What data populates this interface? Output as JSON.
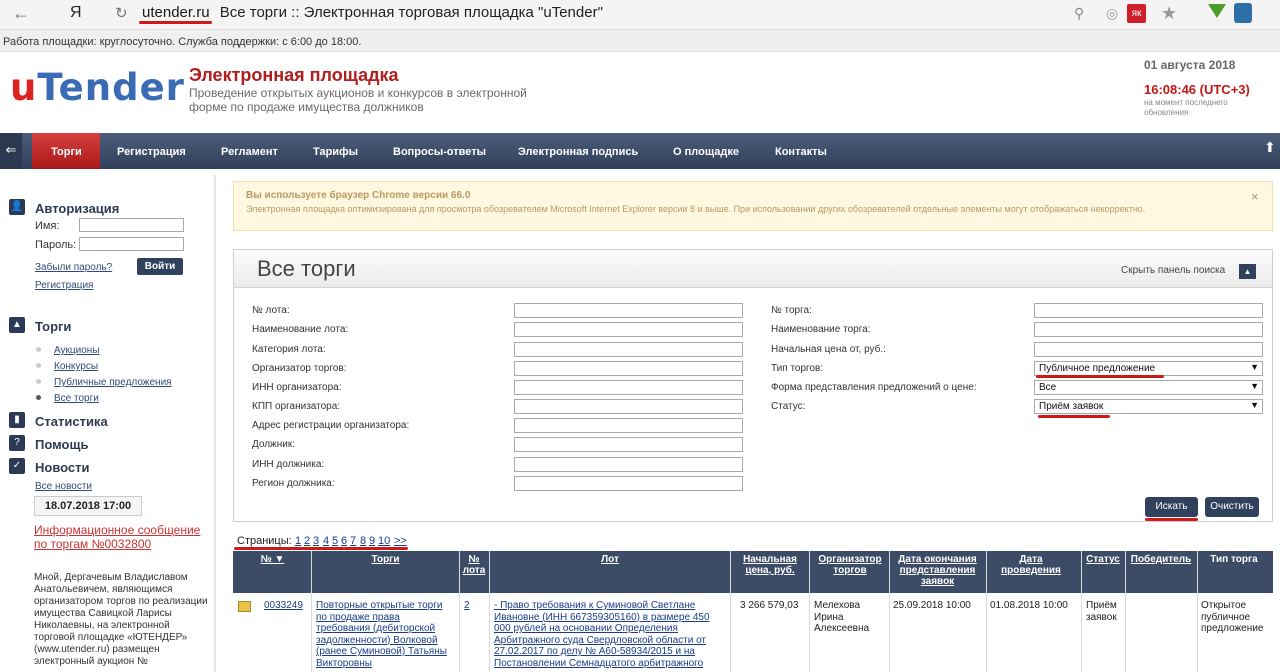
{
  "browser": {
    "back": "←",
    "yandex": "Я",
    "reload": "↻",
    "domain": "utender.ru",
    "page_title": "Все торги :: Электронная торговая площадка \"uTender\"",
    "ext_red": "як"
  },
  "support_line": "Работа площадки: круглосуточно. Служба поддержки: с 6:00 до 18:00.",
  "header": {
    "logo_u": "u",
    "logo_rest": "Tender",
    "title": "Электронная площадка",
    "subtitle": "Проведение открытых аукционов и конкурсов в электронной форме по продаже имущества должников",
    "date": "01 августа 2018",
    "time": "16:08:46 (UTC+3)",
    "time_note": "на момент последнего обновления"
  },
  "nav": {
    "items": [
      "Торги",
      "Регистрация",
      "Регламент",
      "Тарифы",
      "Вопросы-ответы",
      "Электронная подпись",
      "О площадке",
      "Контакты"
    ]
  },
  "sidebar": {
    "auth_title": "Авторизация",
    "name_label": "Имя:",
    "password_label": "Пароль:",
    "forgot": "Забыли пароль?",
    "login": "Войти",
    "register": "Регистрация",
    "trades_title": "Торги",
    "trades_items": [
      "Аукционы",
      "Конкурсы",
      "Публичные предложения",
      "Все торги"
    ],
    "stats_title": "Статистика",
    "help_title": "Помощь",
    "news_title": "Новости",
    "all_news": "Все новости",
    "news_date": "18.07.2018 17:00",
    "news_headline": "Информационное сообщение по торгам №0032800",
    "news_text": "Мной, Дергачевым Владиславом Анатольевичем, являющимся организатором торгов по реализации имущества Савицкой Ларисы Николаевны, на электронной торговой площадке «ЮТЕНДЕР» (www.utender.ru) размещен электронный аукцион №"
  },
  "warning": {
    "title": "Вы используете браузер Chrome версии 66.0",
    "text": "Электронная площадка оптимизирована для просмотра обозревателем Microsoft Internet Explorer версии 8 и выше. При использовании других обозревателей отдельные элементы могут отображаться некорректно.",
    "close": "×"
  },
  "search": {
    "title": "Все торги",
    "hide_panel": "Скрыть панель поиска",
    "left_labels": [
      "№ лота:",
      "Наименование лота:",
      "Категория лота:",
      "Организатор торгов:",
      "ИНН организатора:",
      "КПП организатора:",
      "Адрес регистрации организатора:",
      "Должник:",
      "ИНН должника:",
      "Регион должника:"
    ],
    "right_labels": [
      "№ торга:",
      "Наименование торга:",
      "Начальная цена от, руб.:",
      "Тип торгов:",
      "Форма представления предложений о цене:",
      "Статус:"
    ],
    "trade_type_value": "Публичное предложение",
    "price_form_value": "Все",
    "status_value": "Приём заявок",
    "search_btn": "Искать",
    "clear_btn": "Очистить"
  },
  "pagination": {
    "label": "Страницы:",
    "pages": [
      "1",
      "2",
      "3",
      "4",
      "5",
      "6",
      "7",
      "8",
      "9",
      "10",
      ">>"
    ]
  },
  "table": {
    "headers": [
      "№ ▼",
      "Торги",
      "№ лота",
      "Лот",
      "Начальная цена, руб.",
      "Организатор торгов",
      "Дата окончания представления заявок",
      "Дата проведения",
      "Статус",
      "Победитель",
      "Тип торга"
    ],
    "row": {
      "id": "0033249",
      "trade": "Повторные открытые торги по продаже права требования (дебиторской задолженности) Волковой (ранее Суминовой) Татьяны Викторовны",
      "lot_no": "2",
      "lot": "- Право требования к Суминовой Светлане Ивановне (ИНН 667359305160) в размере 450 000 рублей на основании Определения Арбитражного суда Свердловской области от 27.02.2017 по делу № А60-58934/2015 и на Постановлении Семнадцатого арбитражного",
      "price": "3 266 579,03",
      "organizer": "Мелехова Ирина Алексеевна",
      "deadline": "25.09.2018 10:00",
      "date": "01.08.2018 10:00",
      "status": "Приём заявок",
      "winner": "",
      "type": "Открытое публичное предложение"
    }
  },
  "colors": {
    "accent_red": "#d01818",
    "nav_dark": "#30415e"
  }
}
